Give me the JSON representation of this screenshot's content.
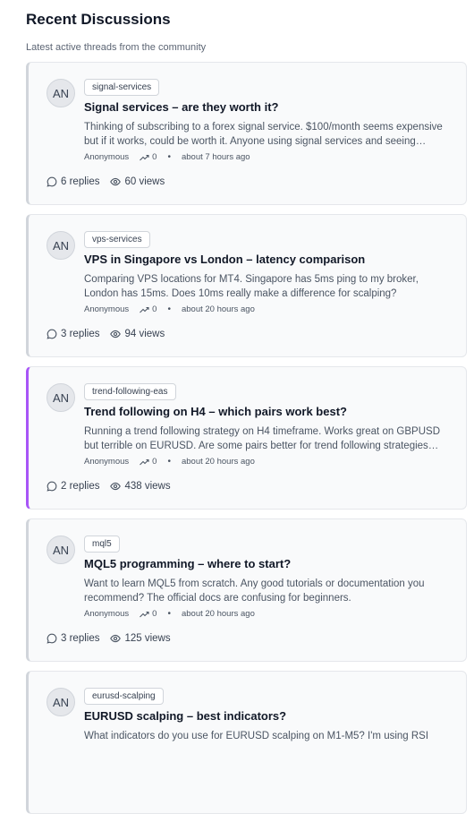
{
  "header": {
    "title": "Recent Discussions",
    "subtitle": "Latest active threads from the community"
  },
  "accent_color": "#a855f7",
  "threads": [
    {
      "avatar": "AN",
      "tag": "signal-services",
      "title": "Signal services – are they worth it?",
      "excerpt": "Thinking of subscribing to a forex signal service. $100/month seems expensive but if it works, could be worth it. Anyone using signal services and seeing consistent profits?",
      "author": "Anonymous",
      "score": "0",
      "time": "about 7 hours ago",
      "replies": "6 replies",
      "views": "60 views",
      "highlighted": false
    },
    {
      "avatar": "AN",
      "tag": "vps-services",
      "title": "VPS in Singapore vs London – latency comparison",
      "excerpt": "Comparing VPS locations for MT4. Singapore has 5ms ping to my broker, London has 15ms. Does 10ms really make a difference for scalping?",
      "author": "Anonymous",
      "score": "0",
      "time": "about 20 hours ago",
      "replies": "3 replies",
      "views": "94 views",
      "highlighted": false
    },
    {
      "avatar": "AN",
      "tag": "trend-following-eas",
      "title": "Trend following on H4 – which pairs work best?",
      "excerpt": "Running a trend following strategy on H4 timeframe. Works great on GBPUSD but terrible on EURUSD. Are some pairs better for trend following strategies than others?",
      "author": "Anonymous",
      "score": "0",
      "time": "about 20 hours ago",
      "replies": "2 replies",
      "views": "438 views",
      "highlighted": true
    },
    {
      "avatar": "AN",
      "tag": "mql5",
      "title": "MQL5 programming – where to start?",
      "excerpt": "Want to learn MQL5 from scratch. Any good tutorials or documentation you recommend? The official docs are confusing for beginners.",
      "author": "Anonymous",
      "score": "0",
      "time": "about 20 hours ago",
      "replies": "3 replies",
      "views": "125 views",
      "highlighted": false
    },
    {
      "avatar": "AN",
      "tag": "eurusd-scalping",
      "title": "EURUSD scalping – best indicators?",
      "excerpt": "What indicators do you use for EURUSD scalping on M1-M5? I'm using RSI",
      "author": "",
      "score": "",
      "time": "",
      "replies": "",
      "views": "",
      "highlighted": false
    }
  ]
}
